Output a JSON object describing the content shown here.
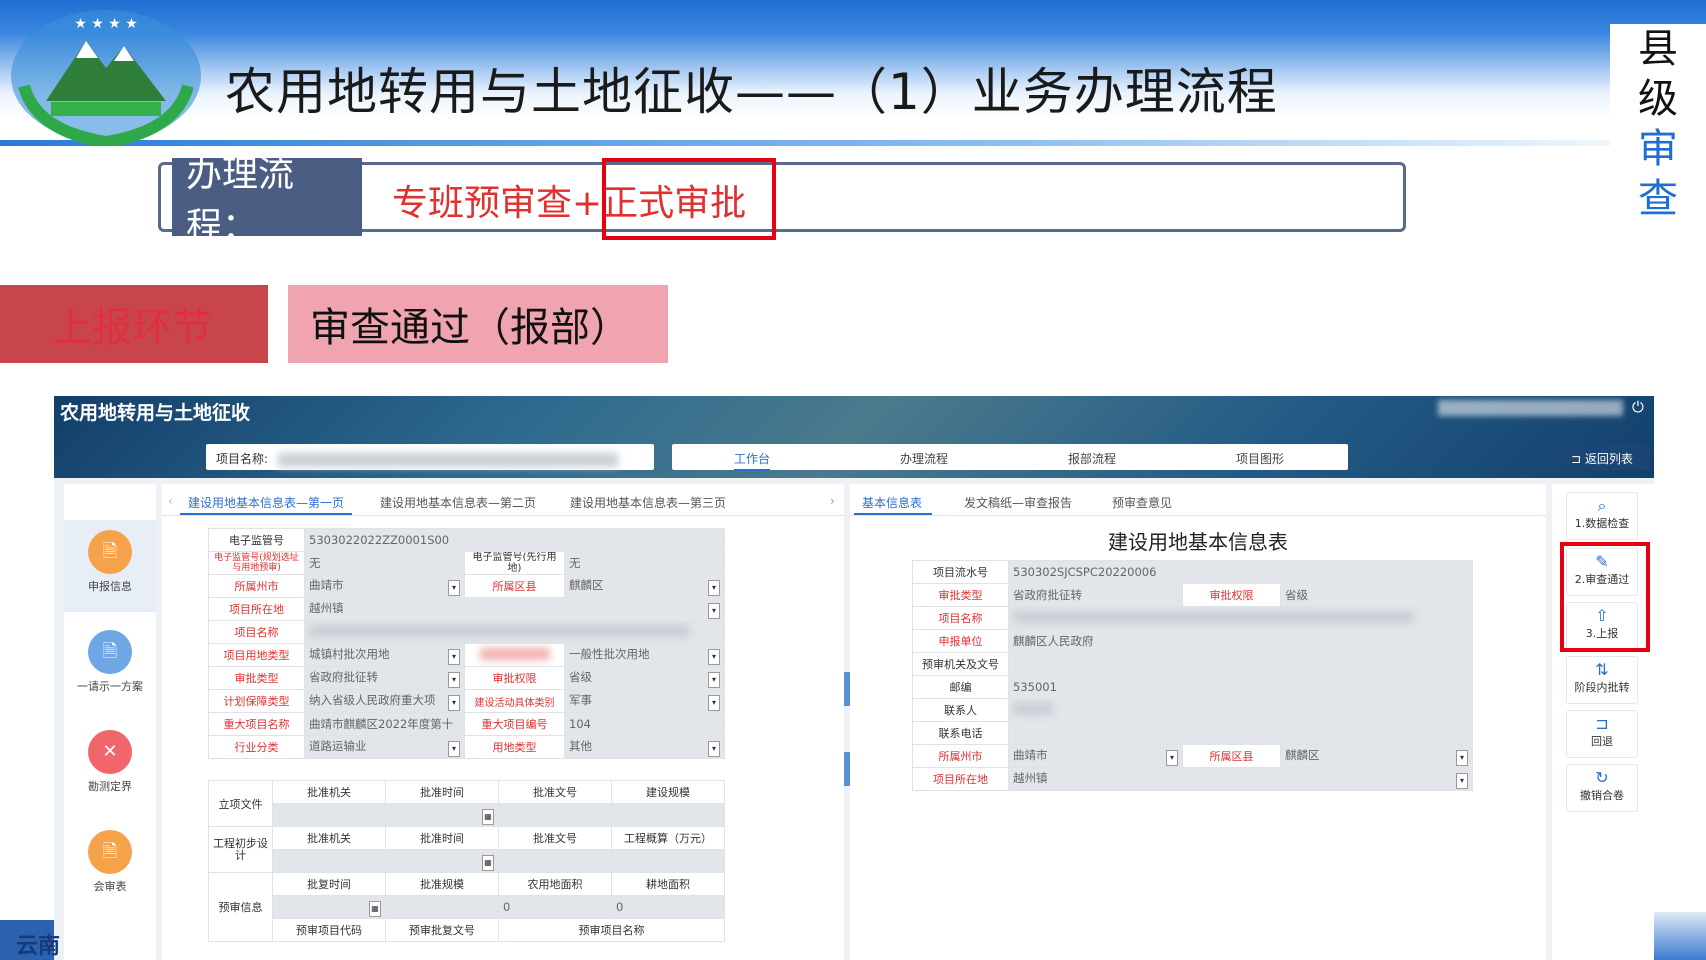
{
  "slide": {
    "title": "农用地转用与土地征收——（1）业务办理流程",
    "vertical_label": [
      "县",
      "级",
      "审",
      "查"
    ],
    "flow_label": "办理流程：",
    "flow_text_a": "专班预审查+",
    "flow_text_b": "正式审批",
    "stage_prev": "上报环节",
    "stage_current": "审查通过（报部）",
    "footer_text": "云南"
  },
  "app": {
    "title": "农用地转用与土地征收",
    "project_name_label": "项目名称:",
    "nav_tabs": [
      "工作台",
      "办理流程",
      "报部流程",
      "项目图形"
    ],
    "back_button": "返回列表",
    "sidebar": [
      "申报信息",
      "一请示一方案",
      "勘测定界",
      "会审表"
    ],
    "left_tabs": [
      "建设用地基本信息表—第一页",
      "建设用地基本信息表—第二页",
      "建设用地基本信息表—第三页"
    ],
    "left_form": {
      "e_code_label": "电子监管号",
      "e_code": "5303022022ZZ0001S00",
      "e_code_plan_label": "电子监管号(规划选址与用地预审)",
      "e_code_plan": "无",
      "e_code_pre_label": "电子监管号(先行用地)",
      "e_code_pre": "无",
      "city_label": "所属州市",
      "city": "曲靖市",
      "county_label": "所属区县",
      "county": "麒麟区",
      "location_label": "项目所在地",
      "location": "越州镇",
      "name_label": "项目名称",
      "land_type_label": "项目用地类型",
      "land_type": "城镇村批次用地",
      "land_type2": "一般性批次用地",
      "approve_type_label": "审批类型",
      "approve_type": "省政府批征转",
      "approve_auth_label": "审批权限",
      "approve_auth": "省级",
      "plan_label": "计划保障类型",
      "plan": "纳入省级人民政府重大项",
      "activity_label": "建设活动具体类别",
      "activity": "军事",
      "major_name_label": "重大项目名称",
      "major_name": "曲靖市麒麟区2022年度第十",
      "major_no_label": "重大项目编号",
      "major_no": "104",
      "industry_label": "行业分类",
      "industry": "道路运输业",
      "use_type_label": "用地类型",
      "use_type": "其他",
      "g1_label": "立项文件",
      "g1_cols": [
        "批准机关",
        "批准时间",
        "批准文号",
        "建设规模"
      ],
      "g2_label": "工程初步设计",
      "g2_cols": [
        "批准机关",
        "批准时间",
        "批准文号",
        "工程概算（万元）"
      ],
      "g3_label": "预审信息",
      "g3_cols": [
        "批复时间",
        "批准规模",
        "农用地面积",
        "耕地面积"
      ],
      "g3_vals": [
        "0",
        "0"
      ],
      "g3_cols2": [
        "预审项目代码",
        "预审批复文号",
        "预审项目名称"
      ]
    },
    "right_tabs": [
      "基本信息表",
      "发文稿纸—审查报告",
      "预审查意见"
    ],
    "right_form": {
      "title": "建设用地基本信息表",
      "serial_label": "项目流水号",
      "serial": "530302SJCSPC20220006",
      "approve_type_label": "审批类型",
      "approve_type": "省政府批征转",
      "approve_auth_label": "审批权限",
      "approve_auth": "省级",
      "name_label": "项目名称",
      "unit_label": "申报单位",
      "unit": "麒麟区人民政府",
      "preorg_label": "预审机关及文号",
      "zip_label": "邮编",
      "zip": "535001",
      "contact_label": "联系人",
      "phone_label": "联系电话",
      "city_label": "所属州市",
      "city": "曲靖市",
      "county_label": "所属区县",
      "county": "麒麟区",
      "location_label": "项目所在地",
      "location": "越州镇"
    },
    "actions": [
      "1.数据检查",
      "2.审查通过",
      "3.上报",
      "阶段内批转",
      "回退",
      "撤销合卷"
    ]
  }
}
